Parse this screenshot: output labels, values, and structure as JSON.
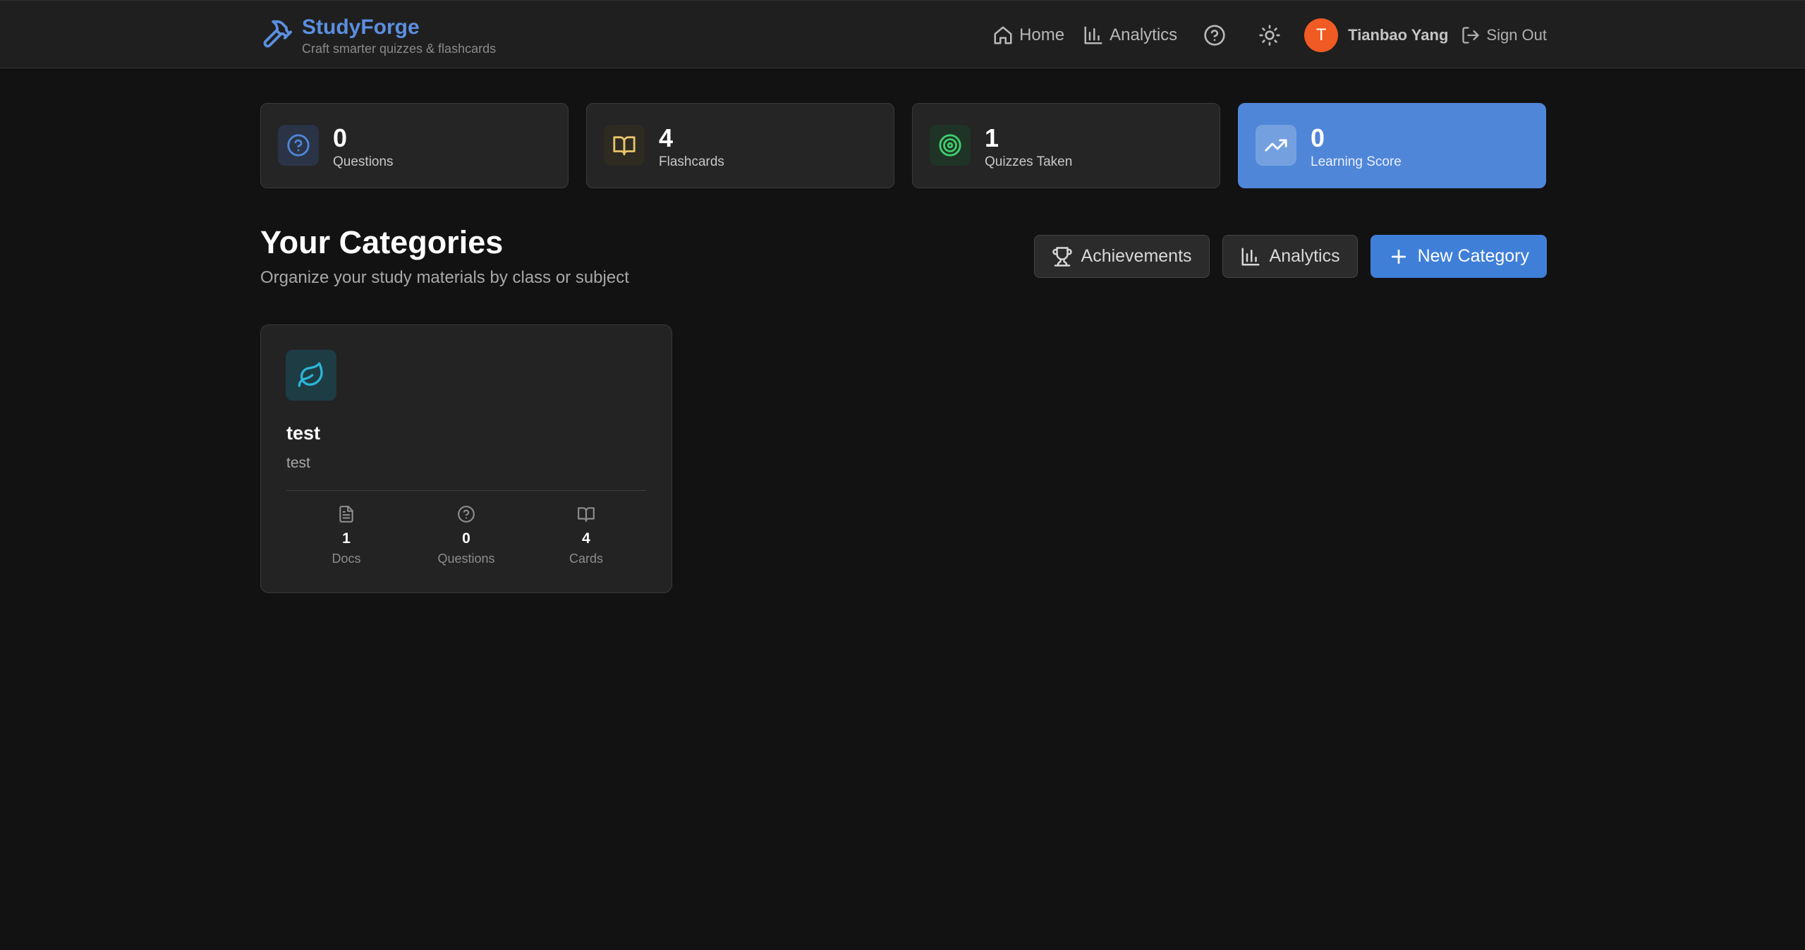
{
  "brand": {
    "title": "StudyForge",
    "subtitle": "Craft smarter quizzes & flashcards",
    "icon": "hammer-icon",
    "color": "#5b8fe0"
  },
  "nav": {
    "home": "Home",
    "analytics": "Analytics",
    "help_icon": "help-circle-icon",
    "theme_icon": "sun-icon",
    "user": {
      "initial": "T",
      "name": "Tianbao Yang",
      "avatar_color": "#f05a23"
    },
    "sign_out": "Sign Out"
  },
  "stats": [
    {
      "value": "0",
      "label": "Questions",
      "icon": "help-circle-icon",
      "color": "#4f86d8"
    },
    {
      "value": "4",
      "label": "Flashcards",
      "icon": "book-open-icon",
      "color": "#e8c46a"
    },
    {
      "value": "1",
      "label": "Quizzes Taken",
      "icon": "target-icon",
      "color": "#3ecf6e"
    },
    {
      "value": "0",
      "label": "Learning Score",
      "icon": "trending-up-icon",
      "color": "#4f86d8"
    }
  ],
  "section": {
    "title": "Your Categories",
    "subtitle": "Organize your study materials by class or subject"
  },
  "actions": {
    "achievements": "Achievements",
    "analytics": "Analytics",
    "new_category": "New Category"
  },
  "categories": [
    {
      "name": "test",
      "description": "test",
      "icon": "leaf-icon",
      "icon_color": "#2bb5d6",
      "stats": [
        {
          "value": "1",
          "label": "Docs",
          "icon": "file-text-icon"
        },
        {
          "value": "0",
          "label": "Questions",
          "icon": "help-circle-icon"
        },
        {
          "value": "4",
          "label": "Cards",
          "icon": "book-open-icon"
        }
      ]
    }
  ]
}
